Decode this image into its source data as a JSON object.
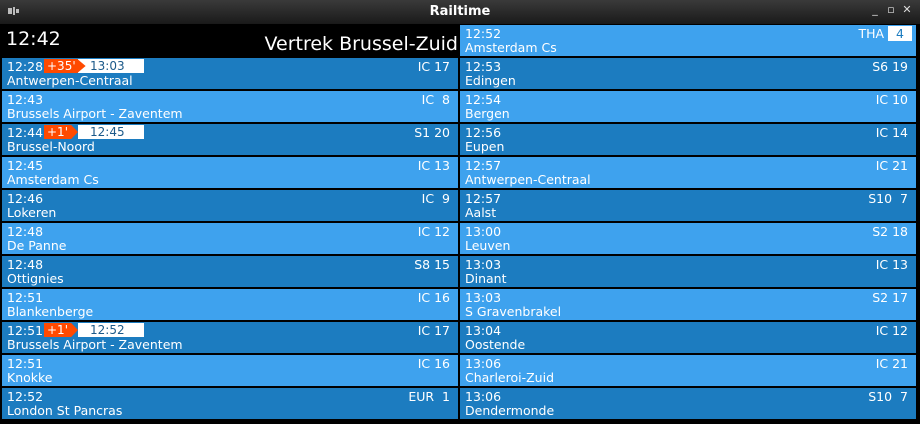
{
  "window": {
    "title": "Railtime"
  },
  "header": {
    "clock": "12:42",
    "title": "Vertrek Brussel-Zuid"
  },
  "left_rows": [
    {
      "time": "12:28",
      "delay": "+35'",
      "new_time": "13:03",
      "dest": "Antwerpen-Centraal",
      "train": "IC 17"
    },
    {
      "time": "12:43",
      "dest": "Brussels Airport - Zaventem",
      "train": "IC  8"
    },
    {
      "time": "12:44",
      "delay": "+1'",
      "new_time": "12:45",
      "dest": "Brussel-Noord",
      "train": "S1 20"
    },
    {
      "time": "12:45",
      "dest": "Amsterdam Cs",
      "train": "IC 13"
    },
    {
      "time": "12:46",
      "dest": "Lokeren",
      "train": "IC  9"
    },
    {
      "time": "12:48",
      "dest": "De Panne",
      "train": "IC 12"
    },
    {
      "time": "12:48",
      "dest": "Ottignies",
      "train": "S8 15"
    },
    {
      "time": "12:51",
      "dest": "Blankenberge",
      "train": "IC 16"
    },
    {
      "time": "12:51",
      "delay": "+1'",
      "new_time": "12:52",
      "dest": "Brussels Airport - Zaventem",
      "train": "IC 17"
    },
    {
      "time": "12:51",
      "dest": "Knokke",
      "train": "IC 16"
    },
    {
      "time": "12:52",
      "dest": "London St Pancras",
      "train": "EUR  1"
    }
  ],
  "right_rows": [
    {
      "time": "12:52",
      "dest": "Amsterdam Cs",
      "train": "THA",
      "platform": "4"
    },
    {
      "time": "12:53",
      "dest": "Edingen",
      "train": "S6 19"
    },
    {
      "time": "12:54",
      "dest": "Bergen",
      "train": "IC 10"
    },
    {
      "time": "12:56",
      "dest": "Eupen",
      "train": "IC 14"
    },
    {
      "time": "12:57",
      "dest": "Antwerpen-Centraal",
      "train": "IC 21"
    },
    {
      "time": "12:57",
      "dest": "Aalst",
      "train": "S10  7"
    },
    {
      "time": "13:00",
      "dest": "Leuven",
      "train": "S2 18"
    },
    {
      "time": "13:03",
      "dest": "Dinant",
      "train": "IC 13"
    },
    {
      "time": "13:03",
      "dest": "S Gravenbrakel",
      "train": "S2 17"
    },
    {
      "time": "13:04",
      "dest": "Oostende",
      "train": "IC 12"
    },
    {
      "time": "13:06",
      "dest": "Charleroi-Zuid",
      "train": "IC 21"
    },
    {
      "time": "13:06",
      "dest": "Dendermonde",
      "train": "S10  7"
    }
  ],
  "colors": {
    "row_dark": "#1c7cc0",
    "row_light": "#3ea2ee",
    "delay": "#ff4a00"
  }
}
